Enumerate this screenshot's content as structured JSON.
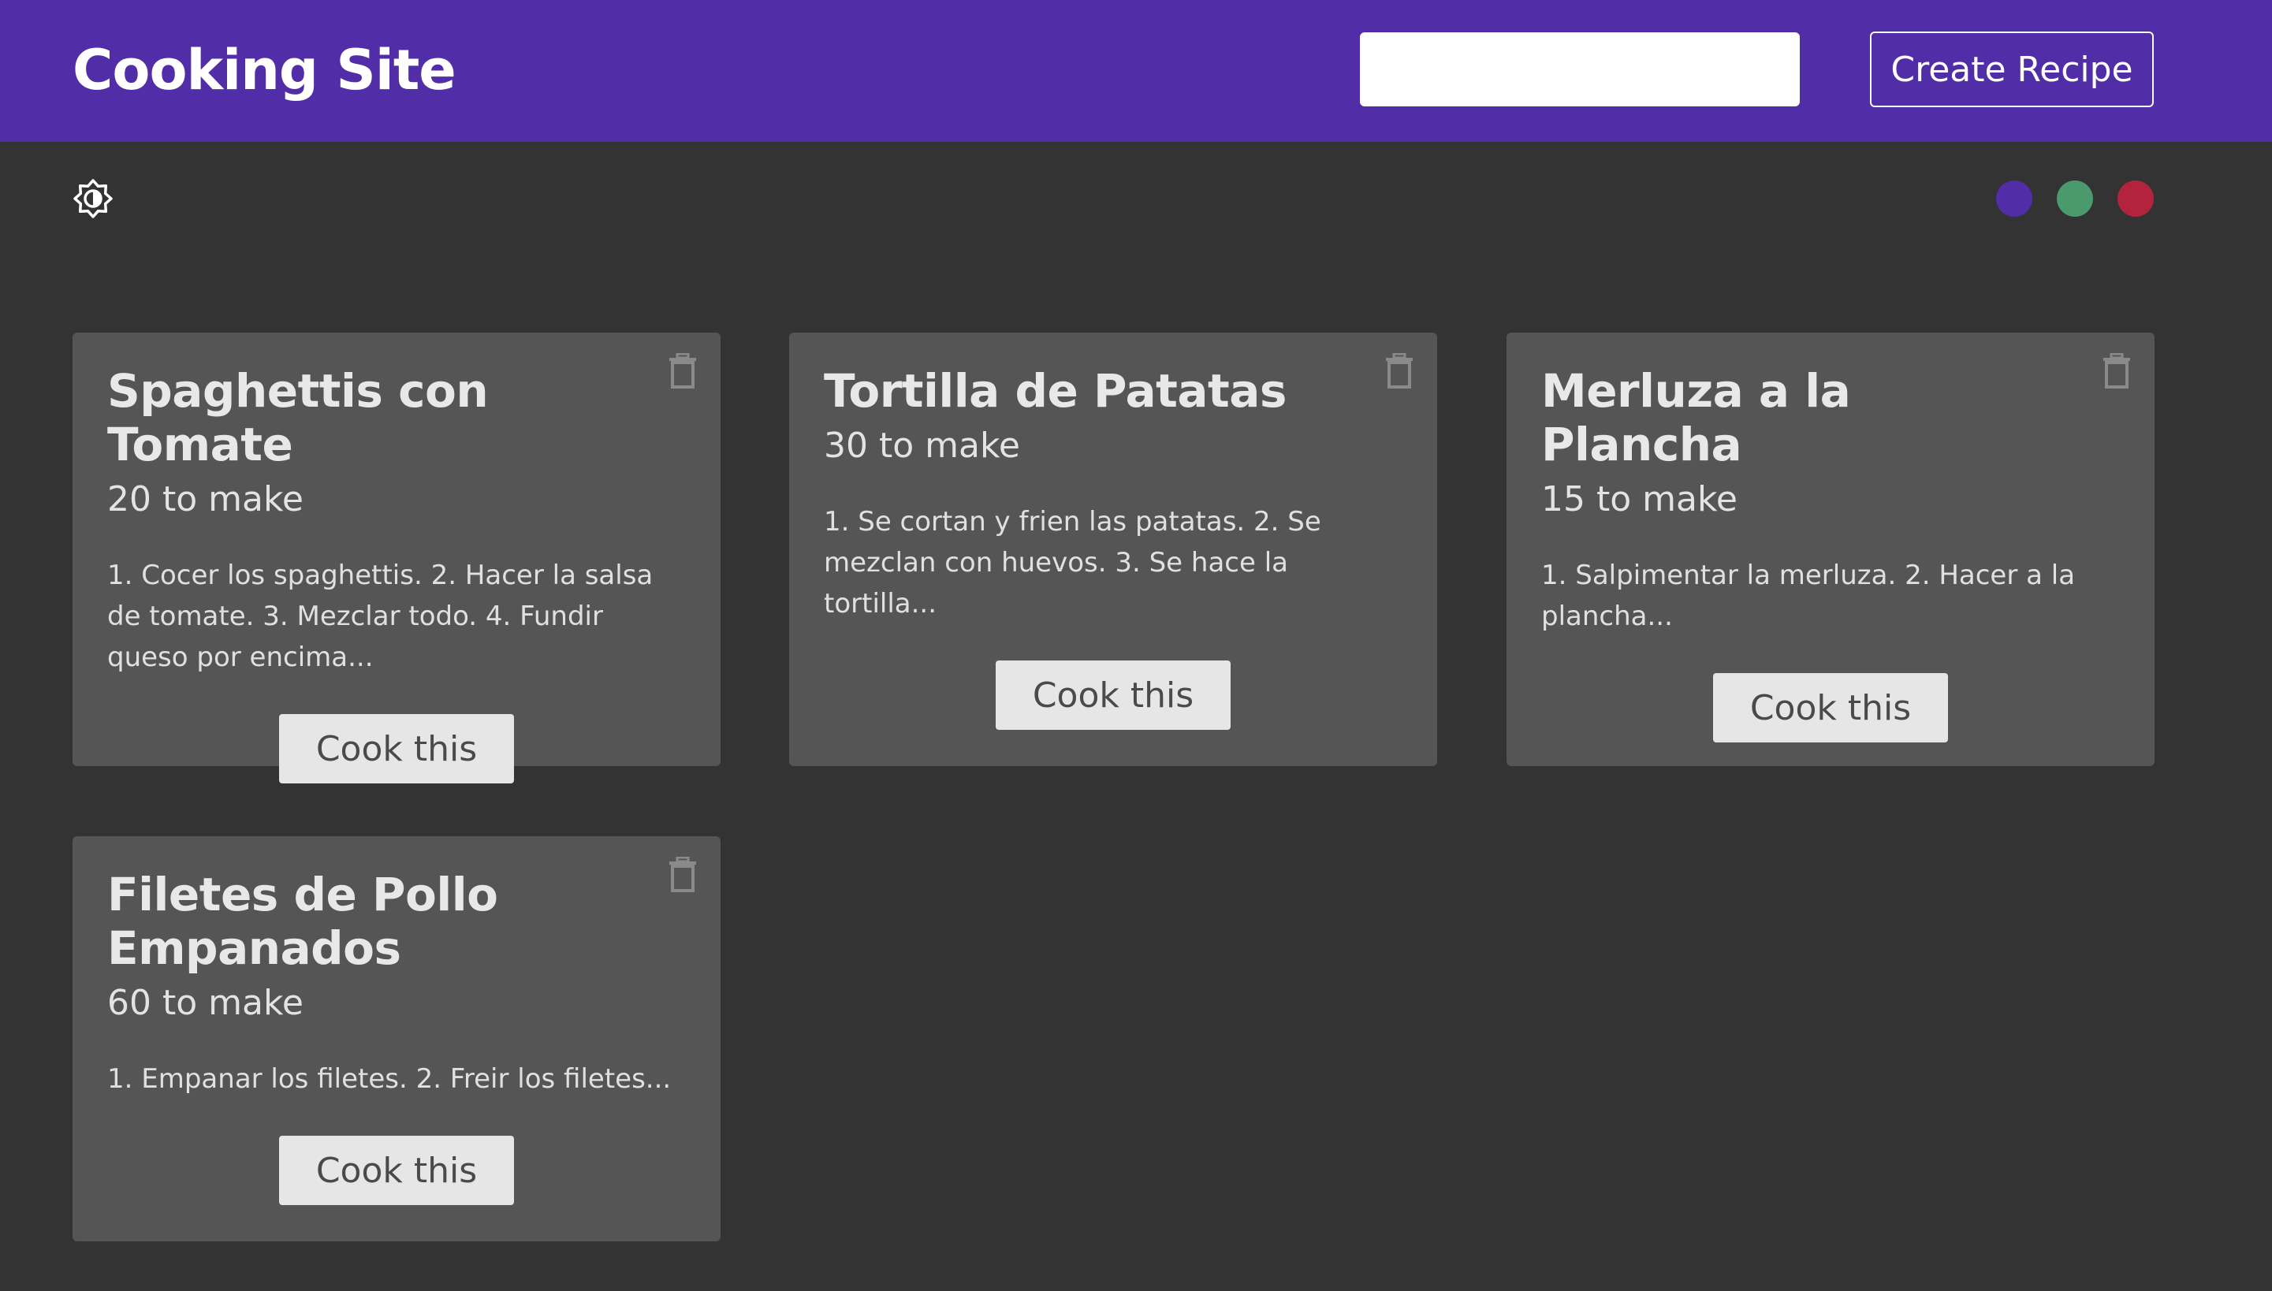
{
  "header": {
    "brand": "Cooking Site",
    "search_value": "",
    "create_label": "Create Recipe"
  },
  "toolbar": {
    "theme_icon": "theme-brightness-icon",
    "swatches": [
      {
        "name": "purple",
        "color": "#512da8"
      },
      {
        "name": "green",
        "color": "#4a9a6e"
      },
      {
        "name": "red",
        "color": "#b3243c"
      }
    ]
  },
  "recipes": [
    {
      "title": "Spaghettis con Tomate",
      "time": "20 to make",
      "description": "1. Cocer los spaghettis. 2. Hacer la salsa de tomate. 3. Mezclar todo. 4. Fundir queso por encima...",
      "button": "Cook this"
    },
    {
      "title": "Tortilla de Patatas",
      "time": "30 to make",
      "description": "1. Se cortan y frien las patatas. 2. Se mezclan con huevos. 3. Se hace la tortilla...",
      "button": "Cook this"
    },
    {
      "title": "Merluza a la Plancha",
      "time": "15 to make",
      "description": "1. Salpimentar la merluza. 2. Hacer a la plancha...",
      "button": "Cook this"
    },
    {
      "title": "Filetes de Pollo Empanados",
      "time": "60 to make",
      "description": "1. Empanar los filetes. 2. Freir los filetes...",
      "button": "Cook this"
    }
  ]
}
